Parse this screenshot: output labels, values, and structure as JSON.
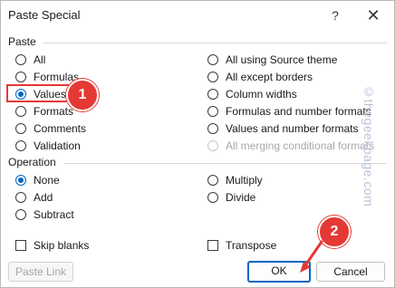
{
  "dialog": {
    "title": "Paste Special",
    "help": "?",
    "close": "✕"
  },
  "paste": {
    "label": "Paste",
    "left_options": [
      {
        "label": "All",
        "checked": false
      },
      {
        "label": "Formulas",
        "checked": false
      },
      {
        "label": "Values",
        "checked": true
      },
      {
        "label": "Formats",
        "checked": false
      },
      {
        "label": "Comments",
        "checked": false
      },
      {
        "label": "Validation",
        "checked": false
      }
    ],
    "right_options": [
      {
        "label": "All using Source theme",
        "checked": false,
        "disabled": false
      },
      {
        "label": "All except borders",
        "checked": false,
        "disabled": false
      },
      {
        "label": "Column widths",
        "checked": false,
        "disabled": false
      },
      {
        "label": "Formulas and number formats",
        "checked": false,
        "disabled": false
      },
      {
        "label": "Values and number formats",
        "checked": false,
        "disabled": false
      },
      {
        "label": "All merging conditional formats",
        "checked": false,
        "disabled": true
      }
    ]
  },
  "operation": {
    "label": "Operation",
    "left_options": [
      {
        "label": "None",
        "checked": true
      },
      {
        "label": "Add",
        "checked": false
      },
      {
        "label": "Subtract",
        "checked": false
      }
    ],
    "right_options": [
      {
        "label": "Multiply",
        "checked": false
      },
      {
        "label": "Divide",
        "checked": false
      }
    ]
  },
  "checkboxes": {
    "skip_blanks": {
      "label": "Skip blanks",
      "checked": false
    },
    "transpose": {
      "label": "Transpose",
      "checked": false
    }
  },
  "buttons": {
    "paste_link": "Paste Link",
    "ok": "OK",
    "cancel": "Cancel"
  },
  "annotations": {
    "step1": "1",
    "step2": "2",
    "watermark": "©thegeekpage.com"
  },
  "colors": {
    "accent": "#0067c0",
    "annotation": "#e53935"
  }
}
